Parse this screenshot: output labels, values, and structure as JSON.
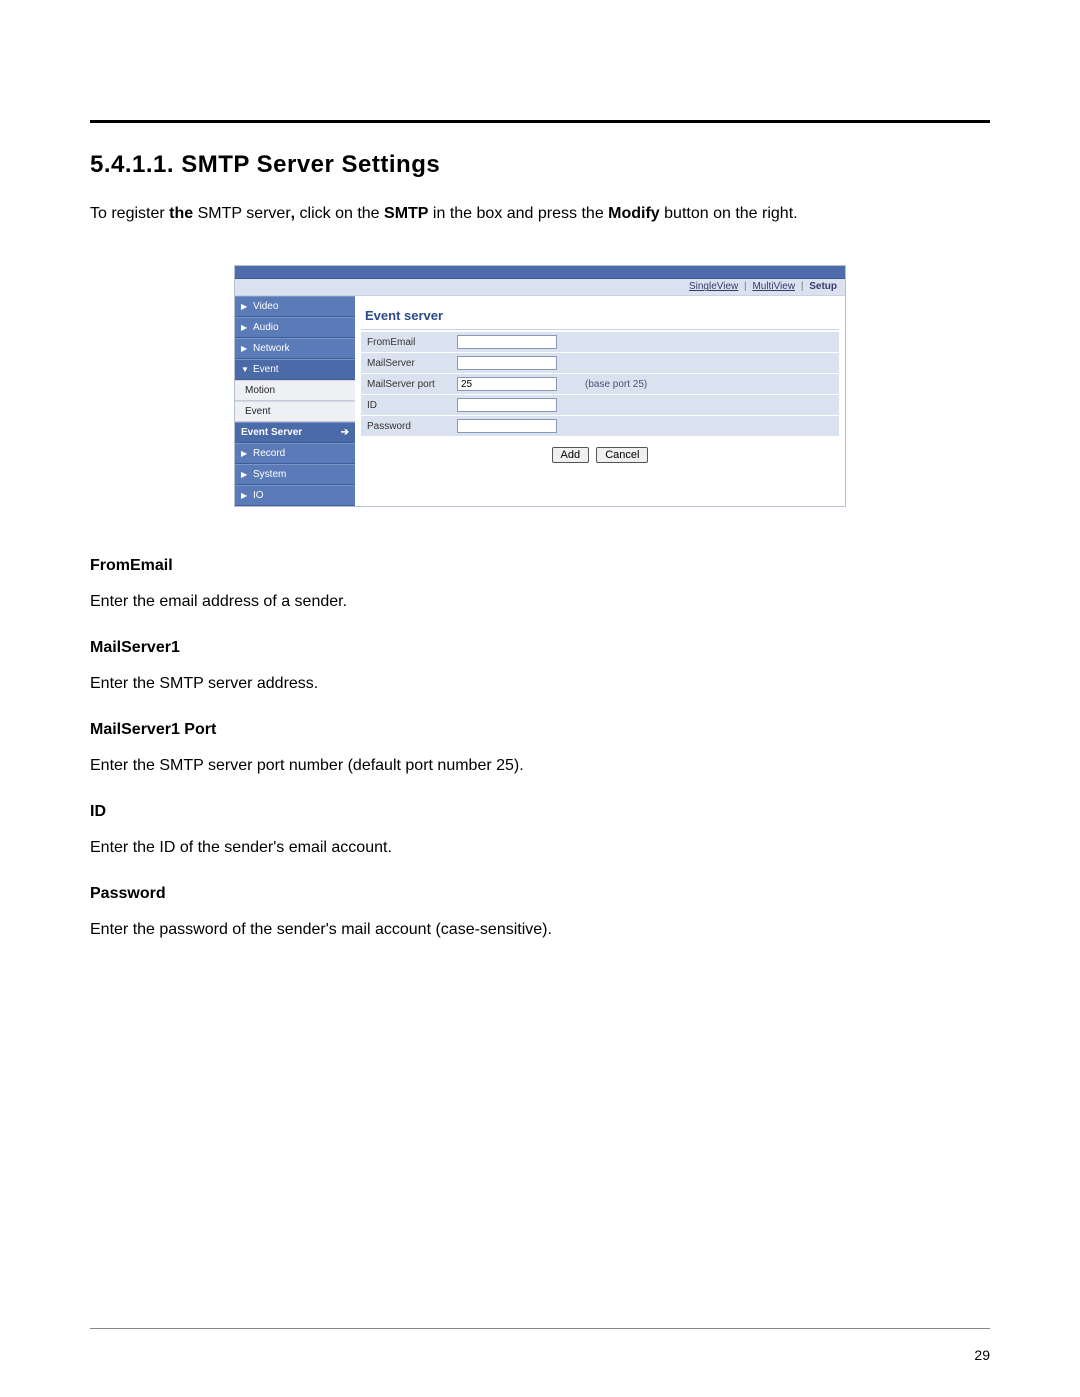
{
  "heading": "5.4.1.1. SMTP Server Settings",
  "intro": {
    "part1": "To register ",
    "b1": "the",
    "part2": " SMTP server",
    "comma": ",",
    "part3": " click on the ",
    "b2": "SMTP",
    "part4": " in the box and press the ",
    "b3": "Modify",
    "part5": " button on the right."
  },
  "ui": {
    "topnav": {
      "link1": "SingleView",
      "link2": "MultiView",
      "setup": "Setup"
    },
    "sidebar": {
      "video": "Video",
      "audio": "Audio",
      "network": "Network",
      "event": "Event",
      "motion": "Motion",
      "event_sub": "Event",
      "event_server": "Event Server",
      "record": "Record",
      "system": "System",
      "io": "IO"
    },
    "content": {
      "title": "Event server",
      "from_email_label": "FromEmail",
      "mail_server_label": "MailServer",
      "mail_server_port_label": "MailServer port",
      "mail_server_port_value": "25",
      "mail_server_port_note": "(base port 25)",
      "id_label": "ID",
      "password_label": "Password",
      "add_btn": "Add",
      "cancel_btn": "Cancel"
    }
  },
  "desc": {
    "from_email": {
      "term": "FromEmail",
      "text": "Enter the email address of a sender."
    },
    "mailserver1": {
      "term": "MailServer1",
      "text": "Enter the SMTP server address."
    },
    "mailserver1_port": {
      "term": "MailServer1 Port",
      "text": "Enter the SMTP server port number (default port number 25)."
    },
    "id": {
      "term": "ID",
      "text": "Enter the ID of the sender's email account."
    },
    "password": {
      "term": "Password",
      "text": "Enter the password of the sender's mail account (case-sensitive)."
    }
  },
  "page_number": "29"
}
